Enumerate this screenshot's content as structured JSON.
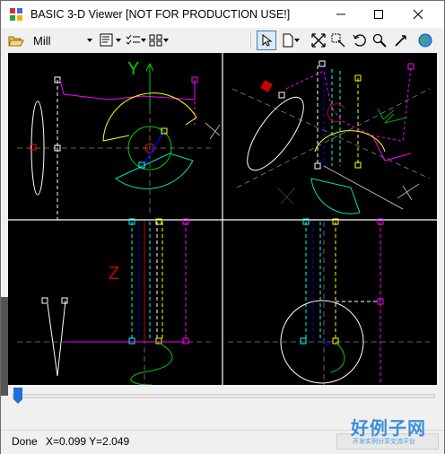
{
  "window": {
    "title": "BASIC 3-D Viewer [NOT FOR PRODUCTION USE!]"
  },
  "toolbar": {
    "mode": "Mill",
    "tools": [
      {
        "name": "open-folder-icon"
      },
      {
        "name": "mode-dropdown"
      },
      {
        "name": "properties-icon"
      },
      {
        "name": "check-list-icon"
      },
      {
        "name": "grid-layout-icon"
      },
      {
        "name": "select-arrow-icon"
      },
      {
        "name": "page-icon"
      },
      {
        "name": "fit-view-icon"
      },
      {
        "name": "zoom-window-icon"
      },
      {
        "name": "rotate-icon"
      },
      {
        "name": "zoom-icon"
      },
      {
        "name": "pan-icon"
      },
      {
        "name": "globe-icon"
      }
    ]
  },
  "viewports": {
    "axis_labels": [
      "Y",
      "Z"
    ],
    "layout": "four views"
  },
  "status": {
    "state": "Done",
    "coords": "X=0.099 Y=2.049"
  },
  "watermark": {
    "brand": "好例子网",
    "tagline": "开发实例分享交流平台"
  },
  "colors": {
    "background": "#000000",
    "magenta": "#ff00ff",
    "yellow": "#ffff00",
    "cyan": "#00ffff",
    "green": "#00ff00",
    "blue": "#0000ff",
    "red": "#ff0000",
    "white": "#ffffff"
  }
}
